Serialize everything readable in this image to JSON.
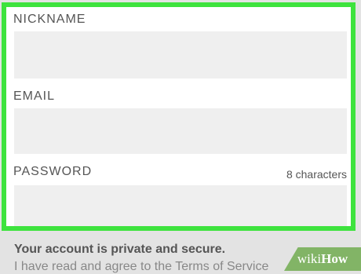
{
  "form": {
    "nickname": {
      "label": "NICKNAME",
      "value": "",
      "placeholder": ""
    },
    "email": {
      "label": "EMAIL",
      "value": "",
      "placeholder": ""
    },
    "password": {
      "label": "PASSWORD",
      "hint": "8 characters",
      "value": "",
      "placeholder": ""
    }
  },
  "footer": {
    "privacy_heading": "Your account is private and secure.",
    "terms_text": "I have read and agree to the Terms of Service"
  },
  "watermark": {
    "brand_light": "wiki",
    "brand_bold": "How"
  },
  "colors": {
    "highlight": "#3ee33e",
    "input_bg": "#efefef",
    "page_bg": "#e3e3e3",
    "label_text": "#555555"
  }
}
